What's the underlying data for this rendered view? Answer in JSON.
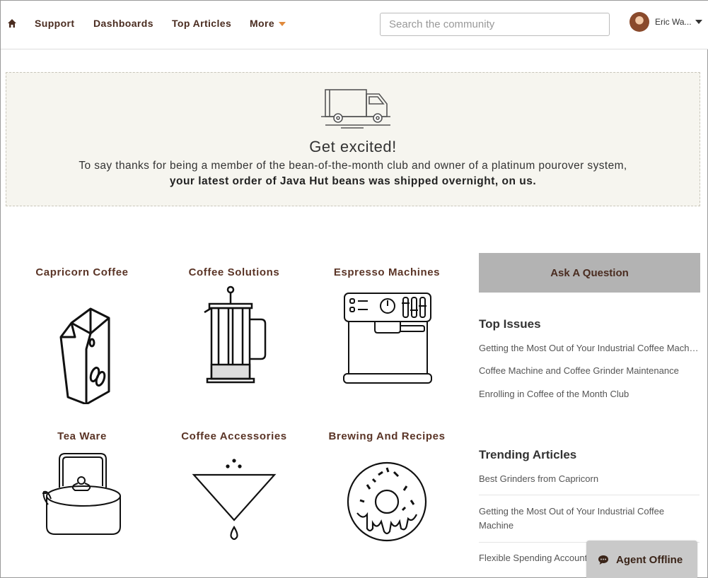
{
  "header": {
    "nav": [
      "Support",
      "Dashboards",
      "Top Articles",
      "More"
    ],
    "search_placeholder": "Search the community",
    "user_name": "Eric Wa..."
  },
  "banner": {
    "title": "Get excited!",
    "text": "To say thanks for being a member of the bean-of-the-month club and owner of a platinum pourover system,",
    "bold_text": "your latest order of Java Hut beans was shipped overnight, on us."
  },
  "tiles": [
    {
      "label": "Capricorn Coffee",
      "icon": "coffee-bag-icon"
    },
    {
      "label": "Coffee Solutions",
      "icon": "french-press-icon"
    },
    {
      "label": "Espresso Machines",
      "icon": "espresso-machine-icon"
    },
    {
      "label": "Tea Ware",
      "icon": "kettle-icon"
    },
    {
      "label": "Coffee Accessories",
      "icon": "pourover-cone-icon"
    },
    {
      "label": "Brewing And Recipes",
      "icon": "donut-icon"
    }
  ],
  "sidebar": {
    "ask_button": "Ask A Question",
    "top_issues_title": "Top Issues",
    "top_issues": [
      "Getting the Most Out of Your Industrial Coffee Machine",
      "Coffee Machine and Coffee Grinder Maintenance",
      "Enrolling in Coffee of the Month Club"
    ],
    "trending_title": "Trending Articles",
    "trending": [
      "Best Grinders from Capricorn",
      "Getting the Most Out of Your Industrial Coffee Machine",
      "Flexible Spending Account"
    ]
  },
  "chat": {
    "label": "Agent Offline"
  },
  "colors": {
    "nav_text": "#4a2c20",
    "accent_caret": "#e08a3c",
    "banner_bg": "#f6f5ef",
    "button_bg": "#b3b3b3"
  }
}
